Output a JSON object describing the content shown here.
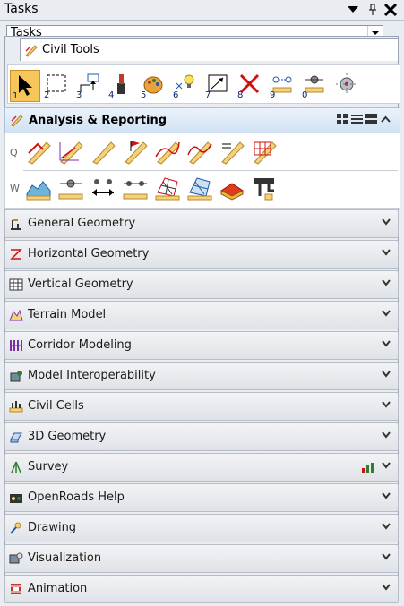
{
  "window": {
    "title": "Tasks"
  },
  "task_selector": {
    "value": "Tasks"
  },
  "civil_tab": {
    "label": "Civil Tools"
  },
  "main_tools": [
    {
      "num": "1",
      "name": "select-element-tool-icon"
    },
    {
      "num": "2",
      "name": "power-selector-tool-icon"
    },
    {
      "num": "3",
      "name": "select-tool-icon"
    },
    {
      "num": "4",
      "name": "attribute-tool-icon"
    },
    {
      "num": "5",
      "name": "symbology-tool-icon"
    },
    {
      "num": "6",
      "name": "light-tool-icon"
    },
    {
      "num": "7",
      "name": "fence-tool-icon"
    },
    {
      "num": "8",
      "name": "delete-element-icon"
    },
    {
      "num": "9",
      "name": "measure-tool-icon"
    },
    {
      "num": "0",
      "name": "point-tool-icon"
    },
    {
      "num": "",
      "name": "snap-tool-icon"
    }
  ],
  "section": {
    "title": "Analysis & Reporting",
    "row_q_label": "Q",
    "row_w_label": "W"
  },
  "accordion": [
    {
      "label": "General Geometry",
      "icon": "general-geometry-icon"
    },
    {
      "label": "Horizontal Geometry",
      "icon": "horizontal-geometry-icon"
    },
    {
      "label": "Vertical Geometry",
      "icon": "vertical-geometry-icon"
    },
    {
      "label": "Terrain Model",
      "icon": "terrain-model-icon"
    },
    {
      "label": "Corridor Modeling",
      "icon": "corridor-modeling-icon"
    },
    {
      "label": "Model Interoperability",
      "icon": "model-interoperability-icon"
    },
    {
      "label": "Civil Cells",
      "icon": "civil-cells-icon"
    },
    {
      "label": "3D Geometry",
      "icon": "3d-geometry-icon"
    },
    {
      "label": "Survey",
      "icon": "survey-icon"
    },
    {
      "label": "OpenRoads Help",
      "icon": "openroads-help-icon"
    },
    {
      "label": "Drawing",
      "icon": "drawing-icon"
    },
    {
      "label": "Visualization",
      "icon": "visualization-icon"
    },
    {
      "label": "Animation",
      "icon": "animation-icon"
    }
  ],
  "colors": {
    "accent": "#f7c65a",
    "header_bg": "#cfe1f2"
  }
}
